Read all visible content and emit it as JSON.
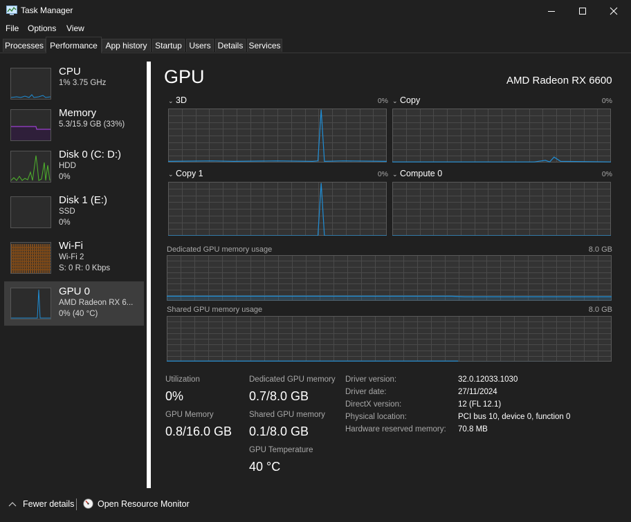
{
  "window": {
    "title": "Task Manager"
  },
  "menu": [
    "File",
    "Options",
    "View"
  ],
  "tabs": [
    "Processes",
    "Performance",
    "App history",
    "Startup",
    "Users",
    "Details",
    "Services"
  ],
  "active_tab": "Performance",
  "sidebar": {
    "items": [
      {
        "name": "CPU",
        "line1": "1% 3.75 GHz",
        "line2": "",
        "color": "#1f8ed6"
      },
      {
        "name": "Memory",
        "line1": "5.3/15.9 GB (33%)",
        "line2": "",
        "color": "#9b3fd0"
      },
      {
        "name": "Disk 0 (C: D:)",
        "line1": "HDD",
        "line2": "0%",
        "color": "#4fb52c"
      },
      {
        "name": "Disk 1 (E:)",
        "line1": "SSD",
        "line2": "0%",
        "color": "#4fb52c"
      },
      {
        "name": "Wi-Fi",
        "line1": "Wi-Fi 2",
        "line2": "S: 0 R: 0 Kbps",
        "color": "#c86a10"
      },
      {
        "name": "GPU 0",
        "line1": "AMD Radeon RX 6...",
        "line2": "0% (40 °C)",
        "color": "#1f8ed6"
      }
    ],
    "selected": "GPU 0"
  },
  "gpu": {
    "title": "GPU",
    "model": "AMD Radeon RX 6600",
    "engines": [
      {
        "name": "3D",
        "percent": "0%"
      },
      {
        "name": "Copy",
        "percent": "0%"
      },
      {
        "name": "Copy 1",
        "percent": "0%"
      },
      {
        "name": "Compute 0",
        "percent": "0%"
      }
    ],
    "dedicated_memory": {
      "label": "Dedicated GPU memory usage",
      "max": "8.0 GB",
      "used_fraction": 0.09
    },
    "shared_memory": {
      "label": "Shared GPU memory usage",
      "max": "8.0 GB",
      "used_fraction": 0.0125
    },
    "stats": {
      "utilization": {
        "label": "Utilization",
        "value": "0%"
      },
      "dedicated": {
        "label": "Dedicated GPU memory",
        "value": "0.7/8.0 GB"
      },
      "gpu_memory": {
        "label": "GPU Memory",
        "value": "0.8/16.0 GB"
      },
      "shared": {
        "label": "Shared GPU memory",
        "value": "0.1/8.0 GB"
      },
      "temperature": {
        "label": "GPU Temperature",
        "value": "40 °C"
      }
    },
    "info": [
      {
        "label": "Driver version:",
        "value": "32.0.12033.1030"
      },
      {
        "label": "Driver date:",
        "value": "27/11/2024"
      },
      {
        "label": "DirectX version:",
        "value": "12 (FL 12.1)"
      },
      {
        "label": "Physical location:",
        "value": "PCI bus 10, device 0, function 0"
      },
      {
        "label": "Hardware reserved memory:",
        "value": "70.8 MB"
      }
    ]
  },
  "footer": {
    "fewer_details": "Fewer details",
    "resource_monitor": "Open Resource Monitor"
  },
  "colors": {
    "background": "#202020",
    "graph_bg": "#333333",
    "grid": "#4a4a4a",
    "gpu_line": "#1f8ed6"
  }
}
